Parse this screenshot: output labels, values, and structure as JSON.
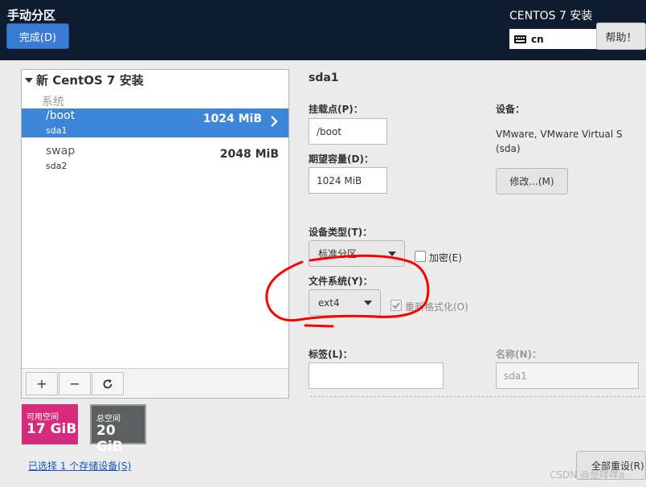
{
  "header": {
    "title": "手动分区",
    "done_button": "完成(D)",
    "product": "CENTOS 7 安装",
    "keyboard_layout": "cn",
    "help_button": "帮助！"
  },
  "partition_list": {
    "group_title": "新 CentOS 7 安装",
    "section": "系统",
    "items": [
      {
        "name": "/boot",
        "device": "sda1",
        "size": "1024 MiB",
        "selected": true
      },
      {
        "name": "swap",
        "device": "sda2",
        "size": "2048 MiB",
        "selected": false
      }
    ],
    "toolbar": {
      "add": "+",
      "remove": "−"
    }
  },
  "capacity": {
    "available_label": "可用空间",
    "available_value": "17 GiB",
    "total_label": "总空间",
    "total_value": "20 GiB"
  },
  "storage_link": "已选择 1 个存储设备(S)",
  "details": {
    "title": "sda1",
    "mount_point_label": "挂载点(P)：",
    "mount_point_value": "/boot",
    "capacity_label": "期望容量(D)：",
    "capacity_value": "1024 MiB",
    "device_label": "设备：",
    "device_name_line1": "VMware, VMware Virtual S",
    "device_name_line2": "(sda)",
    "modify_button": "修改...(M)",
    "device_type_label": "设备类型(T)：",
    "device_type_value": "标准分区",
    "encrypt_label": "加密(E)",
    "filesystem_label": "文件系统(Y)：",
    "filesystem_value": "ext4",
    "reformat_label": "重新格式化(O)",
    "tag_label": "标签(L)：",
    "tag_value": "",
    "name_label": "名称(N)：",
    "name_value": "sda1"
  },
  "reset_button": "全部重设(R)",
  "watermark": "CSDN @是咩咩a",
  "colors": {
    "header_bg": "#0f1b2e",
    "accent_blue": "#3d85d9",
    "available_pink": "#d62b7d",
    "total_gray": "#5d6060",
    "annotation_red": "#ff0000"
  }
}
